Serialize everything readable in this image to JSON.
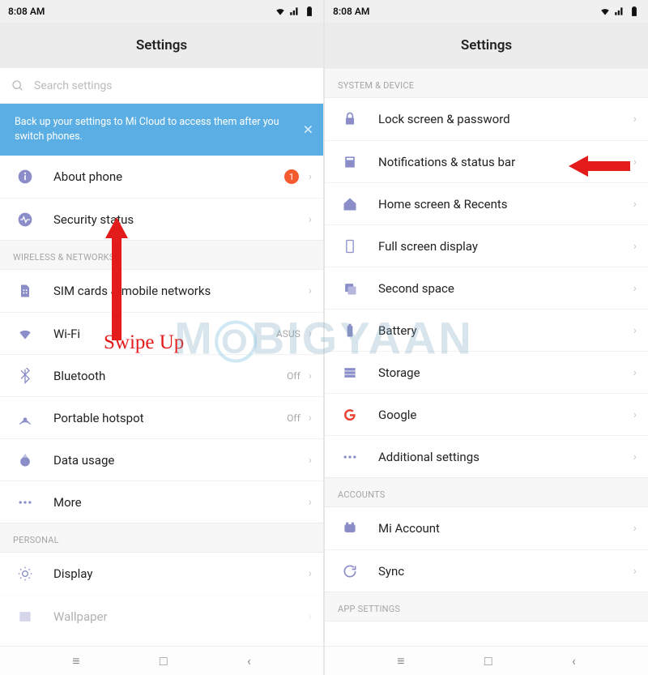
{
  "watermark": "MOBIGYAAN",
  "statusbar": {
    "time": "8:08 AM"
  },
  "title": "Settings",
  "search": {
    "placeholder": "Search settings"
  },
  "banner": {
    "text": "Back up your settings to Mi Cloud to access them after you switch phones."
  },
  "annotations": {
    "swipe_text": "Swipe Up"
  },
  "left": {
    "top": [
      {
        "label": "About phone",
        "badge": "1"
      },
      {
        "label": "Security status"
      }
    ],
    "wireless_header": "WIRELESS & NETWORKS",
    "wireless": [
      {
        "label": "SIM cards & mobile networks"
      },
      {
        "label": "Wi-Fi",
        "value": "ASUS"
      },
      {
        "label": "Bluetooth",
        "value": "Off"
      },
      {
        "label": "Portable hotspot",
        "value": "Off"
      },
      {
        "label": "Data usage"
      },
      {
        "label": "More"
      }
    ],
    "personal_header": "PERSONAL",
    "personal": [
      {
        "label": "Display"
      },
      {
        "label": "Wallpaper"
      }
    ]
  },
  "right": {
    "system_header": "SYSTEM & DEVICE",
    "system": [
      {
        "label": "Lock screen & password"
      },
      {
        "label": "Notifications & status bar"
      },
      {
        "label": "Home screen & Recents"
      },
      {
        "label": "Full screen display"
      },
      {
        "label": "Second space"
      },
      {
        "label": "Battery"
      },
      {
        "label": "Storage"
      },
      {
        "label": "Google"
      },
      {
        "label": "Additional settings"
      }
    ],
    "accounts_header": "ACCOUNTS",
    "accounts": [
      {
        "label": "Mi Account"
      },
      {
        "label": "Sync"
      }
    ],
    "appsettings_header": "APP SETTINGS"
  }
}
